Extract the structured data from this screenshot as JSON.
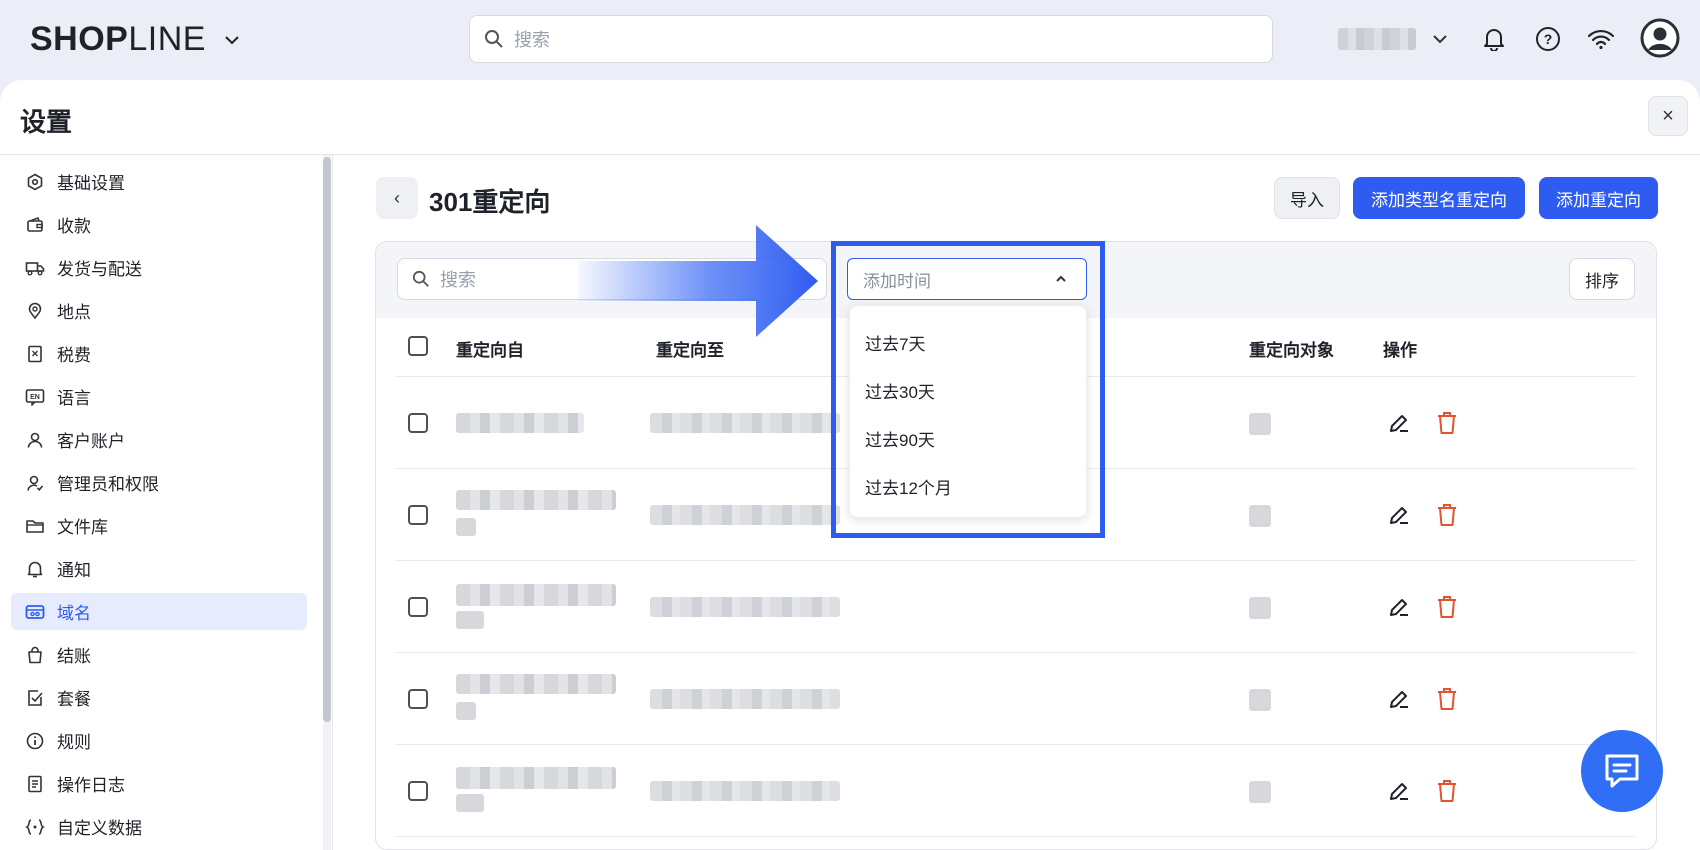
{
  "brand": {
    "logo_bold": "SHOP",
    "logo_rest": "LINE"
  },
  "top_search": {
    "placeholder": "搜索"
  },
  "panel": {
    "title": "设置",
    "close_label": "×"
  },
  "sidebar": {
    "items": [
      {
        "label": "基础设置",
        "icon": "hexagon-settings-icon"
      },
      {
        "label": "收款",
        "icon": "wallet-icon"
      },
      {
        "label": "发货与配送",
        "icon": "truck-icon"
      },
      {
        "label": "地点",
        "icon": "location-pin-icon"
      },
      {
        "label": "税费",
        "icon": "tax-receipt-icon"
      },
      {
        "label": "语言",
        "icon": "language-icon"
      },
      {
        "label": "客户账户",
        "icon": "user-icon"
      },
      {
        "label": "管理员和权限",
        "icon": "admin-user-icon"
      },
      {
        "label": "文件库",
        "icon": "folder-icon"
      },
      {
        "label": "通知",
        "icon": "bell-icon"
      },
      {
        "label": "域名",
        "icon": "domain-icon",
        "active": true
      },
      {
        "label": "结账",
        "icon": "shopping-bag-icon"
      },
      {
        "label": "套餐",
        "icon": "plan-icon"
      },
      {
        "label": "规则",
        "icon": "info-icon"
      },
      {
        "label": "操作日志",
        "icon": "log-icon"
      },
      {
        "label": "自定义数据",
        "icon": "custom-data-icon"
      }
    ]
  },
  "page": {
    "title": "301重定向",
    "back_label": "‹",
    "buttons": {
      "import": "导入",
      "add_type": "添加类型名重定向",
      "add": "添加重定向"
    }
  },
  "toolbar": {
    "search_placeholder": "搜索",
    "sort_label": "排序",
    "time_filter": {
      "placeholder": "添加时间",
      "options": [
        "过去7天",
        "过去30天",
        "过去90天",
        "过去12个月"
      ]
    }
  },
  "table": {
    "headers": {
      "from": "重定向自",
      "to": "重定向至",
      "target": "重定向对象",
      "actions": "操作"
    },
    "row_count": 5
  },
  "colors": {
    "accent": "#2f5cf0",
    "delete": "#e0542e"
  }
}
